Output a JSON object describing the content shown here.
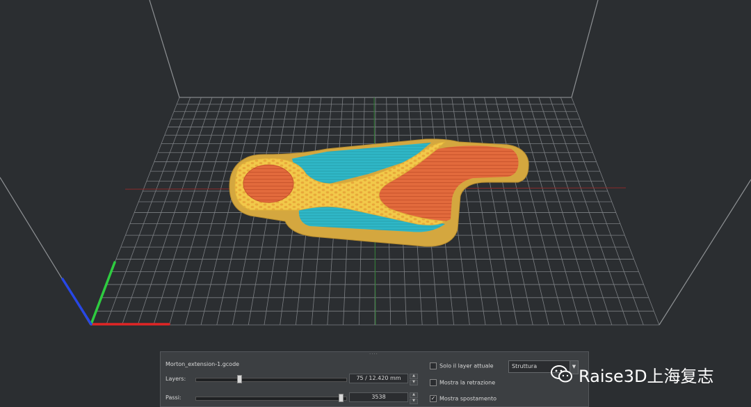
{
  "gcode": {
    "filename": "Morton_extension-1.gcode",
    "layers_label": "Layers:",
    "layers_value": "75 / 12.420 mm",
    "steps_label": "Passi:",
    "steps_value": "3538",
    "layers_fraction": 0.28,
    "steps_fraction": 0.98
  },
  "options": {
    "solo_layer": "Solo il layer attuale",
    "mostra_retrazione": "Mostra la retrazione",
    "mostra_spostamento": "Mostra spostamento",
    "solo_layer_checked": false,
    "mostra_retrazione_checked": false,
    "mostra_spostamento_checked": true
  },
  "view_select": {
    "selected": "Struttura"
  },
  "watermark": {
    "text": "Raise3D上海复志"
  },
  "colors": {
    "background": "#2b2e31",
    "grid": "#8e9194",
    "infill": "#f2c94a",
    "skin": "#e26a3c",
    "support": "#2fb7c7",
    "brim": "#d4a73f"
  }
}
